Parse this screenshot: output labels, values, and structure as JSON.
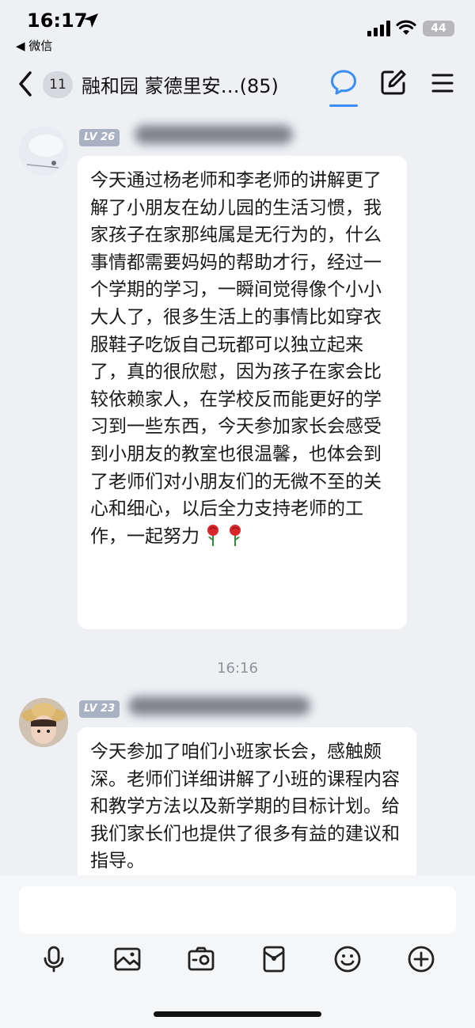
{
  "status_bar": {
    "time": "16:17",
    "back_app": "◀ 微信",
    "battery": "44"
  },
  "nav": {
    "unread_count": "11",
    "title": "融和园 蒙德里安…(85)"
  },
  "messages": [
    {
      "level": "LV 26",
      "text": "今天通过杨老师和李老师的讲解更了解了小朋友在幼儿园的生活习惯，我家孩子在家那纯属是无行为的，什么事情都需要妈妈的帮助才行，经过一个学期的学习，一瞬间觉得像个小小大人了，很多生活上的事情比如穿衣服鞋子吃饭自己玩都可以独立起来了，真的很欣慰，因为孩子在家会比较依赖家人，在学校反而能更好的学习到一些东西，今天参加家长会感受到小朋友的教室也很温馨，也体会到了老师们对小朋友们的无微不至的关心和细心，以后全力支持老师的工作，一起努力",
      "emoji": [
        "rose-icon",
        "rose-icon"
      ]
    },
    {
      "level": "LV 23",
      "text": "今天参加了咱们小班家长会，感触颇深。老师们详细讲解了小班的课程内容和教学方法以及新学期的目标计划。给我们家长们也提供了很多有益的建议和指导。"
    }
  ],
  "timestamp": "16:16",
  "icons": {
    "status": [
      "location-arrow-icon",
      "signal-icon",
      "wifi-icon",
      "battery-icon"
    ],
    "nav": [
      "back-arrow-icon",
      "chat-bubble-icon",
      "edit-icon",
      "menu-icon"
    ],
    "toolbar": [
      "microphone-icon",
      "image-icon",
      "camera-icon",
      "red-packet-icon",
      "emoji-icon",
      "plus-icon"
    ]
  },
  "colors": {
    "accent": "#3a8ef6",
    "background": "#eef0f4",
    "bubble": "#ffffff",
    "level_badge": "#a9b2c2"
  }
}
